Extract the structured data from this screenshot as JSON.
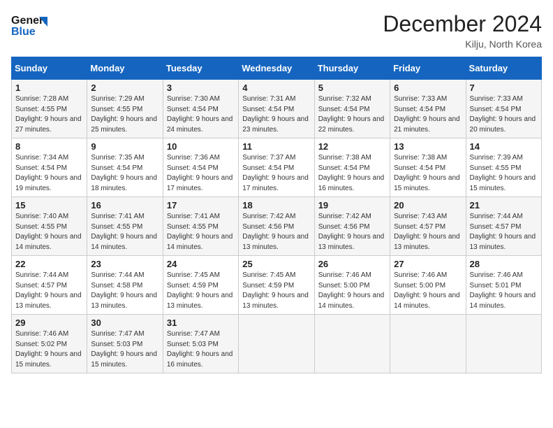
{
  "header": {
    "logo_line1": "General",
    "logo_line2": "Blue",
    "month": "December 2024",
    "location": "Kilju, North Korea"
  },
  "weekdays": [
    "Sunday",
    "Monday",
    "Tuesday",
    "Wednesday",
    "Thursday",
    "Friday",
    "Saturday"
  ],
  "weeks": [
    [
      {
        "day": "1",
        "sunrise": "7:28 AM",
        "sunset": "4:55 PM",
        "daylight": "9 hours and 27 minutes."
      },
      {
        "day": "2",
        "sunrise": "7:29 AM",
        "sunset": "4:55 PM",
        "daylight": "9 hours and 25 minutes."
      },
      {
        "day": "3",
        "sunrise": "7:30 AM",
        "sunset": "4:54 PM",
        "daylight": "9 hours and 24 minutes."
      },
      {
        "day": "4",
        "sunrise": "7:31 AM",
        "sunset": "4:54 PM",
        "daylight": "9 hours and 23 minutes."
      },
      {
        "day": "5",
        "sunrise": "7:32 AM",
        "sunset": "4:54 PM",
        "daylight": "9 hours and 22 minutes."
      },
      {
        "day": "6",
        "sunrise": "7:33 AM",
        "sunset": "4:54 PM",
        "daylight": "9 hours and 21 minutes."
      },
      {
        "day": "7",
        "sunrise": "7:33 AM",
        "sunset": "4:54 PM",
        "daylight": "9 hours and 20 minutes."
      }
    ],
    [
      {
        "day": "8",
        "sunrise": "7:34 AM",
        "sunset": "4:54 PM",
        "daylight": "9 hours and 19 minutes."
      },
      {
        "day": "9",
        "sunrise": "7:35 AM",
        "sunset": "4:54 PM",
        "daylight": "9 hours and 18 minutes."
      },
      {
        "day": "10",
        "sunrise": "7:36 AM",
        "sunset": "4:54 PM",
        "daylight": "9 hours and 17 minutes."
      },
      {
        "day": "11",
        "sunrise": "7:37 AM",
        "sunset": "4:54 PM",
        "daylight": "9 hours and 17 minutes."
      },
      {
        "day": "12",
        "sunrise": "7:38 AM",
        "sunset": "4:54 PM",
        "daylight": "9 hours and 16 minutes."
      },
      {
        "day": "13",
        "sunrise": "7:38 AM",
        "sunset": "4:54 PM",
        "daylight": "9 hours and 15 minutes."
      },
      {
        "day": "14",
        "sunrise": "7:39 AM",
        "sunset": "4:55 PM",
        "daylight": "9 hours and 15 minutes."
      }
    ],
    [
      {
        "day": "15",
        "sunrise": "7:40 AM",
        "sunset": "4:55 PM",
        "daylight": "9 hours and 14 minutes."
      },
      {
        "day": "16",
        "sunrise": "7:41 AM",
        "sunset": "4:55 PM",
        "daylight": "9 hours and 14 minutes."
      },
      {
        "day": "17",
        "sunrise": "7:41 AM",
        "sunset": "4:55 PM",
        "daylight": "9 hours and 14 minutes."
      },
      {
        "day": "18",
        "sunrise": "7:42 AM",
        "sunset": "4:56 PM",
        "daylight": "9 hours and 13 minutes."
      },
      {
        "day": "19",
        "sunrise": "7:42 AM",
        "sunset": "4:56 PM",
        "daylight": "9 hours and 13 minutes."
      },
      {
        "day": "20",
        "sunrise": "7:43 AM",
        "sunset": "4:57 PM",
        "daylight": "9 hours and 13 minutes."
      },
      {
        "day": "21",
        "sunrise": "7:44 AM",
        "sunset": "4:57 PM",
        "daylight": "9 hours and 13 minutes."
      }
    ],
    [
      {
        "day": "22",
        "sunrise": "7:44 AM",
        "sunset": "4:57 PM",
        "daylight": "9 hours and 13 minutes."
      },
      {
        "day": "23",
        "sunrise": "7:44 AM",
        "sunset": "4:58 PM",
        "daylight": "9 hours and 13 minutes."
      },
      {
        "day": "24",
        "sunrise": "7:45 AM",
        "sunset": "4:59 PM",
        "daylight": "9 hours and 13 minutes."
      },
      {
        "day": "25",
        "sunrise": "7:45 AM",
        "sunset": "4:59 PM",
        "daylight": "9 hours and 13 minutes."
      },
      {
        "day": "26",
        "sunrise": "7:46 AM",
        "sunset": "5:00 PM",
        "daylight": "9 hours and 14 minutes."
      },
      {
        "day": "27",
        "sunrise": "7:46 AM",
        "sunset": "5:00 PM",
        "daylight": "9 hours and 14 minutes."
      },
      {
        "day": "28",
        "sunrise": "7:46 AM",
        "sunset": "5:01 PM",
        "daylight": "9 hours and 14 minutes."
      }
    ],
    [
      {
        "day": "29",
        "sunrise": "7:46 AM",
        "sunset": "5:02 PM",
        "daylight": "9 hours and 15 minutes."
      },
      {
        "day": "30",
        "sunrise": "7:47 AM",
        "sunset": "5:03 PM",
        "daylight": "9 hours and 15 minutes."
      },
      {
        "day": "31",
        "sunrise": "7:47 AM",
        "sunset": "5:03 PM",
        "daylight": "9 hours and 16 minutes."
      },
      null,
      null,
      null,
      null
    ]
  ],
  "labels": {
    "sunrise": "Sunrise:",
    "sunset": "Sunset:",
    "daylight": "Daylight:"
  }
}
